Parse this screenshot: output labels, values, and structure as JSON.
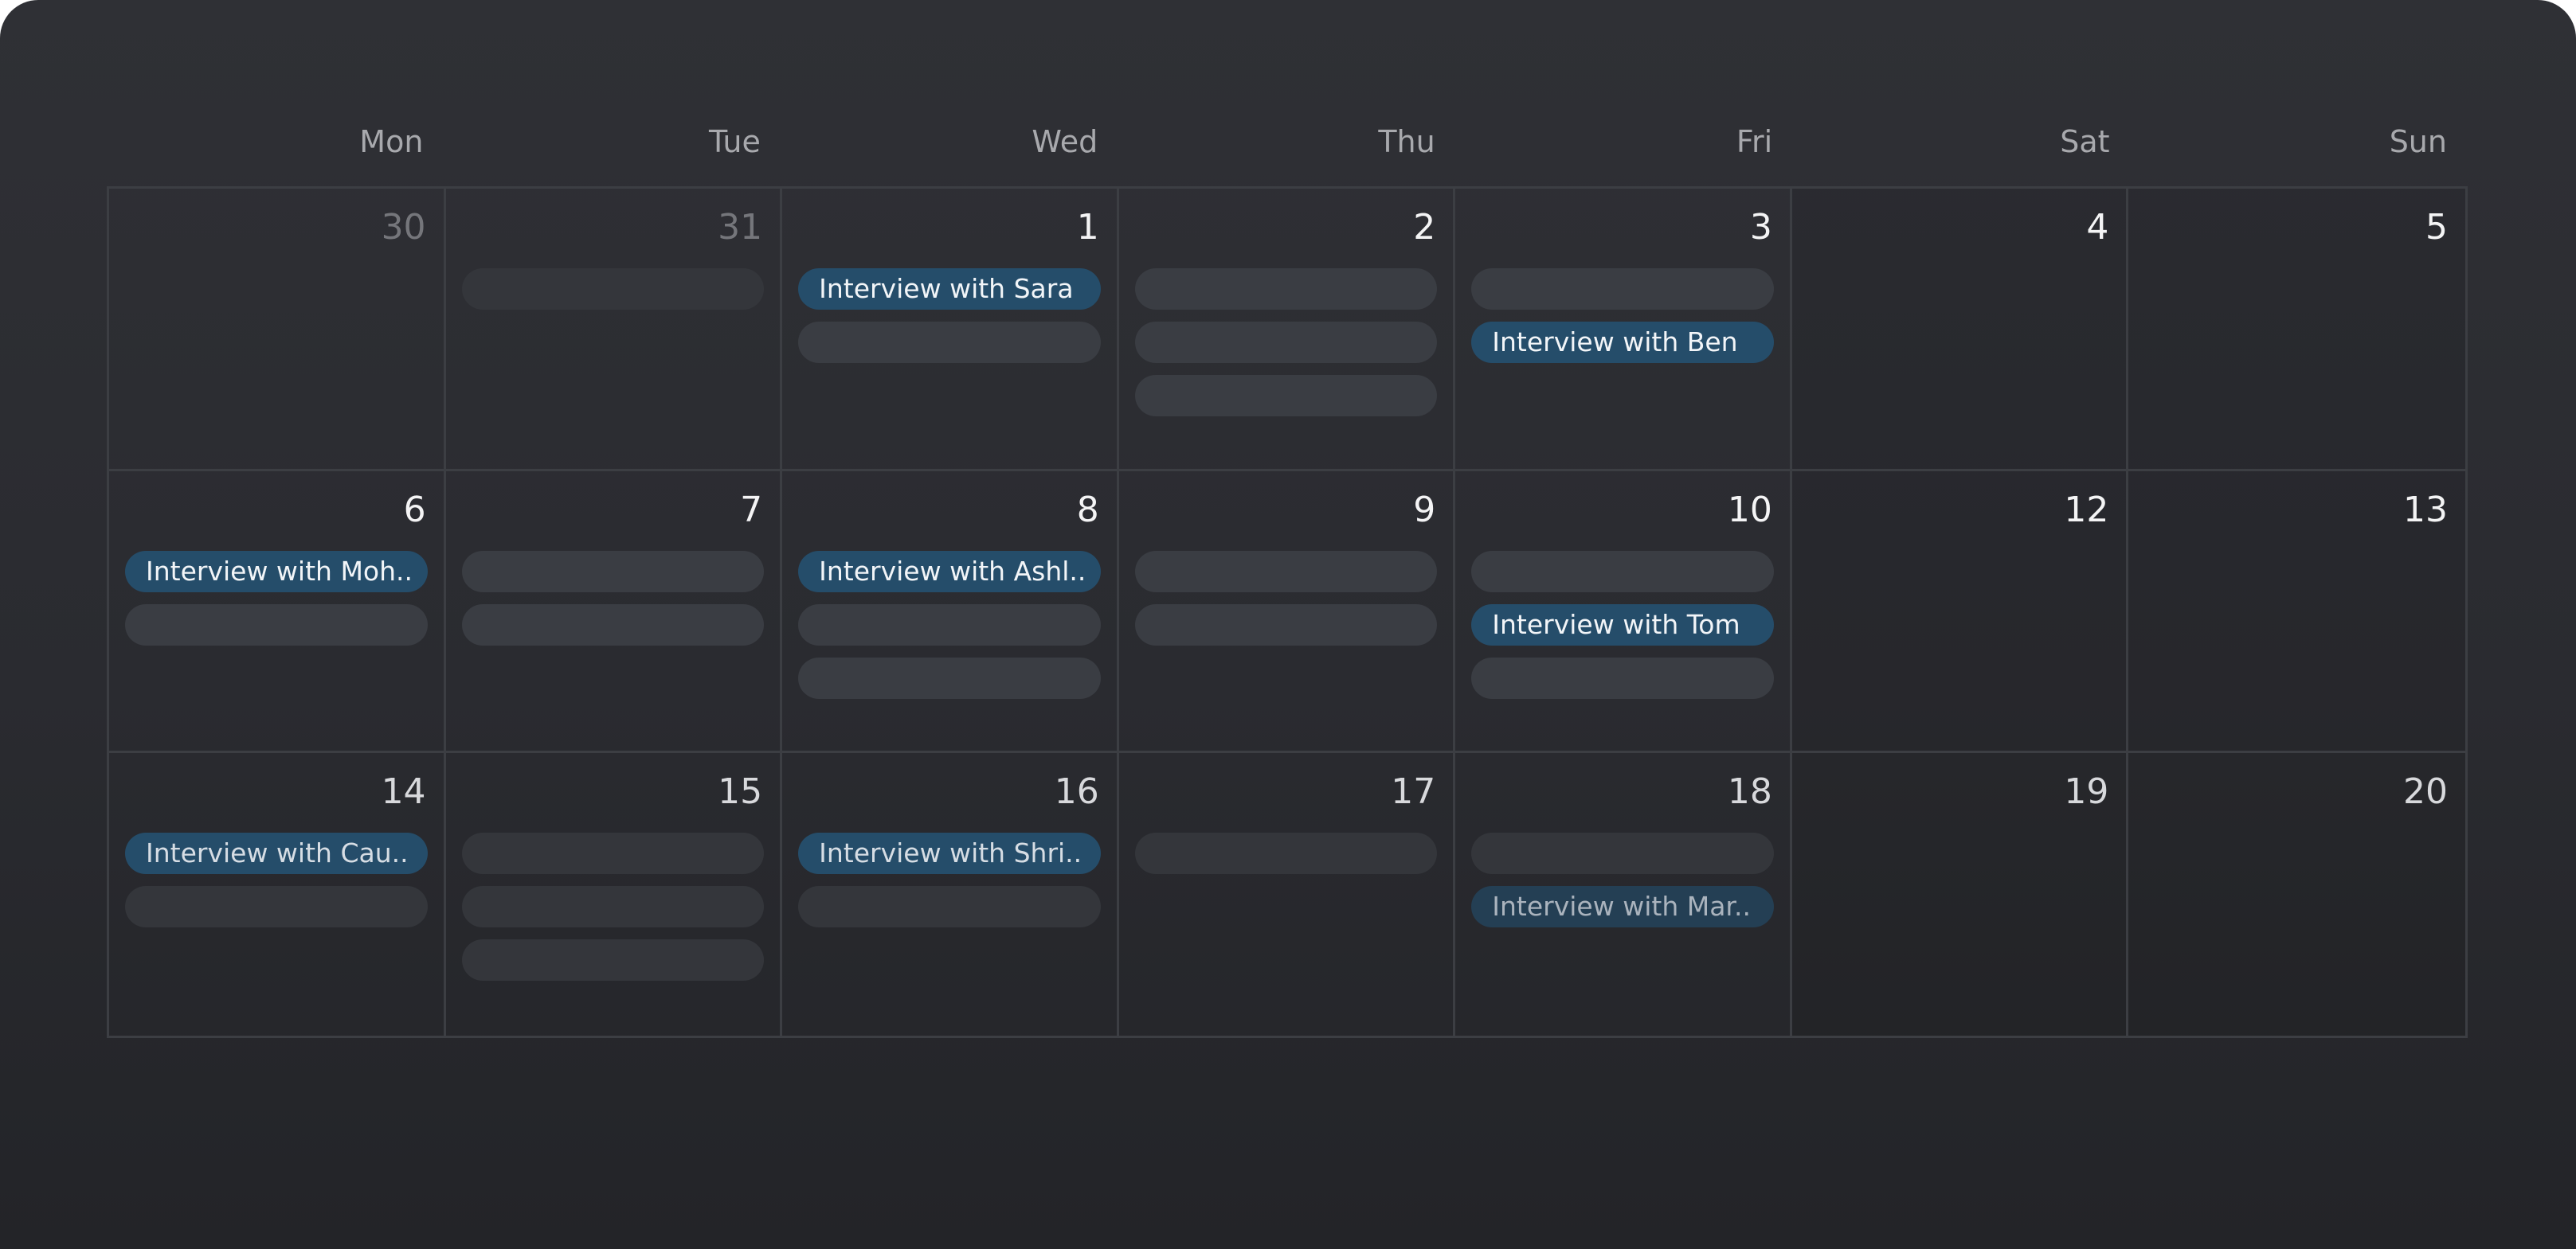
{
  "colors": {
    "window_bg": "#2f3035",
    "grid_line": "#3c3e43",
    "event_accent": "#254d6a",
    "placeholder": "#3a3d43",
    "weekday_text": "#a8a9ad"
  },
  "calendar": {
    "weekdays": [
      "Mon",
      "Tue",
      "Wed",
      "Thu",
      "Fri",
      "Sat",
      "Sun"
    ],
    "weeks": [
      [
        {
          "day": "30",
          "outside": true,
          "events": []
        },
        {
          "day": "31",
          "outside": true,
          "events": [
            {
              "placeholder": true
            }
          ]
        },
        {
          "day": "1",
          "events": [
            {
              "title": "Interview with Sara"
            },
            {
              "placeholder": true
            }
          ]
        },
        {
          "day": "2",
          "events": [
            {
              "placeholder": true
            },
            {
              "placeholder": true
            },
            {
              "placeholder": true
            }
          ]
        },
        {
          "day": "3",
          "events": [
            {
              "placeholder": true
            },
            {
              "title": "Interview with Ben"
            }
          ]
        },
        {
          "day": "4",
          "events": []
        },
        {
          "day": "5",
          "events": []
        }
      ],
      [
        {
          "day": "6",
          "events": [
            {
              "title": "Interview with Moh.."
            },
            {
              "placeholder": true
            }
          ]
        },
        {
          "day": "7",
          "events": [
            {
              "placeholder": true
            },
            {
              "placeholder": true
            }
          ]
        },
        {
          "day": "8",
          "events": [
            {
              "title": "Interview with Ashl.."
            },
            {
              "placeholder": true
            },
            {
              "placeholder": true
            }
          ]
        },
        {
          "day": "9",
          "events": [
            {
              "placeholder": true
            },
            {
              "placeholder": true
            }
          ]
        },
        {
          "day": "10",
          "events": [
            {
              "placeholder": true
            },
            {
              "title": "Interview with Tom"
            },
            {
              "placeholder": true
            }
          ]
        },
        {
          "day": "12",
          "events": []
        },
        {
          "day": "13",
          "events": []
        }
      ],
      [
        {
          "day": "14",
          "events": [
            {
              "title": "Interview with Cau.."
            },
            {
              "placeholder": true
            }
          ]
        },
        {
          "day": "15",
          "events": [
            {
              "placeholder": true
            },
            {
              "placeholder": true
            },
            {
              "placeholder": true
            }
          ]
        },
        {
          "day": "16",
          "events": [
            {
              "title": "Interview with Shri.."
            },
            {
              "placeholder": true
            }
          ]
        },
        {
          "day": "17",
          "events": [
            {
              "placeholder": true
            }
          ]
        },
        {
          "day": "18",
          "events": [
            {
              "placeholder": true
            },
            {
              "title": "Interview with Mar.."
            }
          ]
        },
        {
          "day": "19",
          "events": []
        },
        {
          "day": "20",
          "events": []
        }
      ]
    ]
  }
}
